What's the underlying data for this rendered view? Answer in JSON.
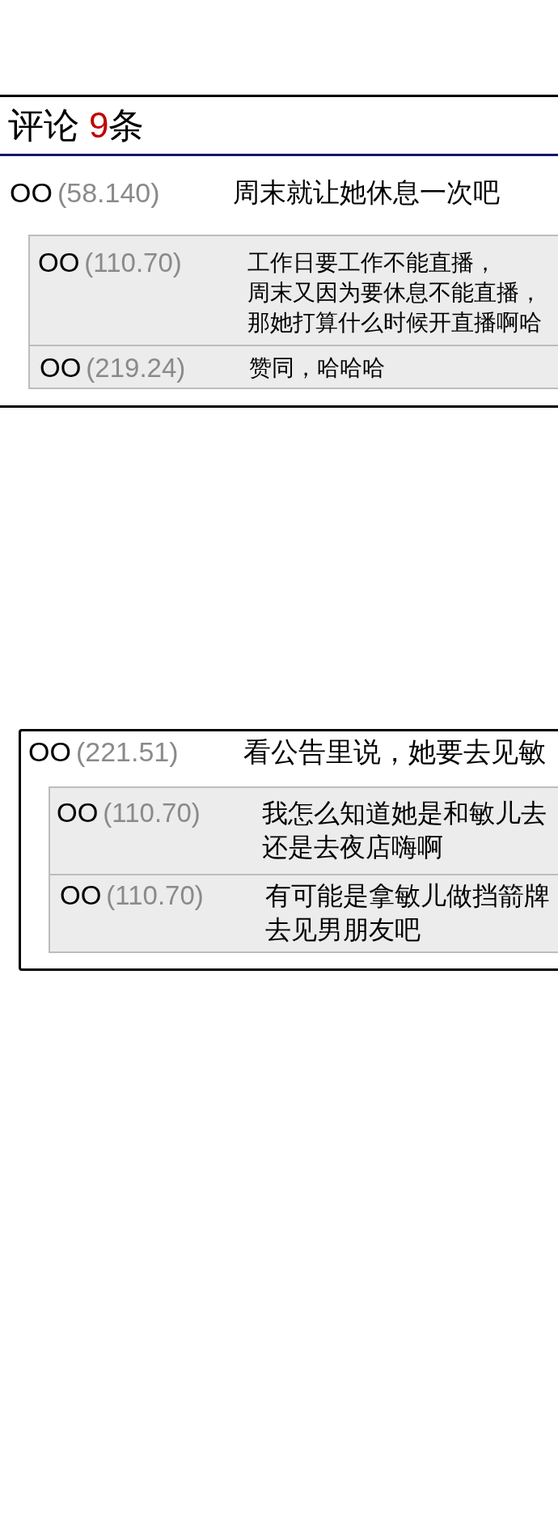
{
  "comment_panel": {
    "header": {
      "label": "评论",
      "count": "9",
      "unit": "条"
    },
    "comments": [
      {
        "author": "OO",
        "score": "(58.140)",
        "lines": [
          "周末就让她休息一次吧"
        ],
        "replies": [
          {
            "author": "OO",
            "score": "(110.70)",
            "lines": [
              "工作日要工作不能直播，",
              "周末又因为要休息不能直播，",
              "那她打算什么时候开直播啊哈"
            ]
          },
          {
            "author": "OO",
            "score": "(219.24)",
            "lines": [
              "赞同，哈哈哈"
            ]
          }
        ]
      }
    ]
  },
  "comment_card": {
    "author": "OO",
    "score": "(221.51)",
    "lines": [
      "看公告里说，她要去见敏"
    ],
    "replies": [
      {
        "author": "OO",
        "score": "(110.70)",
        "lines": [
          "我怎么知道她是和敏儿去",
          "还是去夜店嗨啊"
        ]
      },
      {
        "author": "OO",
        "score": "(110.70)",
        "lines": [
          "有可能是拿敏儿做挡箭牌",
          "去见男朋友吧"
        ]
      }
    ]
  }
}
